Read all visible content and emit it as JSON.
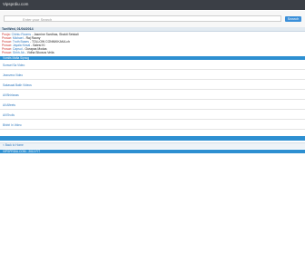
{
  "header": {
    "site_name": "Vipsprdiu.com"
  },
  "search": {
    "placeholder": "Enter your Search",
    "button_label": "Search"
  },
  "date_header": "Tue/Wed, 01/04/2014",
  "info": [
    {
      "key": "Pooja",
      "sub": "Chintu Rooms",
      "value": "Jasmine Sardhas, Shakti Setsiali"
    },
    {
      "key": "Prosar",
      "sub": "Michael",
      "value": "Raj Raony"
    },
    {
      "key": "Prosar",
      "sub": "Truth Bases",
      "value": "TOLLOW CONNIKKAKA.ch"
    },
    {
      "key": "Prosar",
      "sub": "Jayala Kesal",
      "value": "Salesi Ki"
    },
    {
      "key": "Prosar",
      "sub": "Capsul",
      "value": "Ourapas Modas"
    },
    {
      "key": "Prosar",
      "sub": "Shhh Ab",
      "value": "Vidha Sikosos Veila"
    }
  ],
  "section_title": "Vomits Mafia Sipnog",
  "links": [
    "Sonwel Sa Video",
    "Jeanvera Video",
    "Sakasaal Bakh Videos",
    "All Bhirlanas",
    "All Alfeets",
    "All Ehcils",
    "Bhiriri In Video"
  ],
  "back_link": "< Back to Home",
  "footer_section": "VIPSPRDIU.COM - 2013 FIT"
}
